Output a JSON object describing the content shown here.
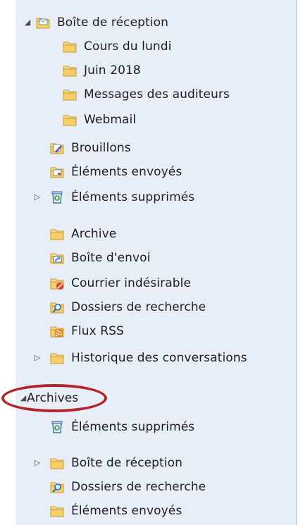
{
  "tree": {
    "inbox": "Boîte de réception",
    "inbox_children": [
      "Cours du lundi",
      "Juin 2018",
      "Messages des auditeurs",
      "Webmail"
    ],
    "drafts": "Brouillons",
    "sent": "Éléments envoyés",
    "deleted": "Éléments supprimés",
    "archive": "Archive",
    "outbox": "Boîte d'envoi",
    "junk": "Courrier indésirable",
    "search_folders": "Dossiers de recherche",
    "rss": "Flux RSS",
    "conversation_history": "Historique des conversations"
  },
  "archives": {
    "label": "Archives",
    "deleted": "Éléments supprimés",
    "inbox": "Boîte de réception",
    "search_folders": "Dossiers de recherche",
    "sent": "Éléments envoyés"
  },
  "colors": {
    "highlight_oval": "#b3232b",
    "pane_bg": "#e8eef7",
    "folder": "#f0c35a"
  }
}
